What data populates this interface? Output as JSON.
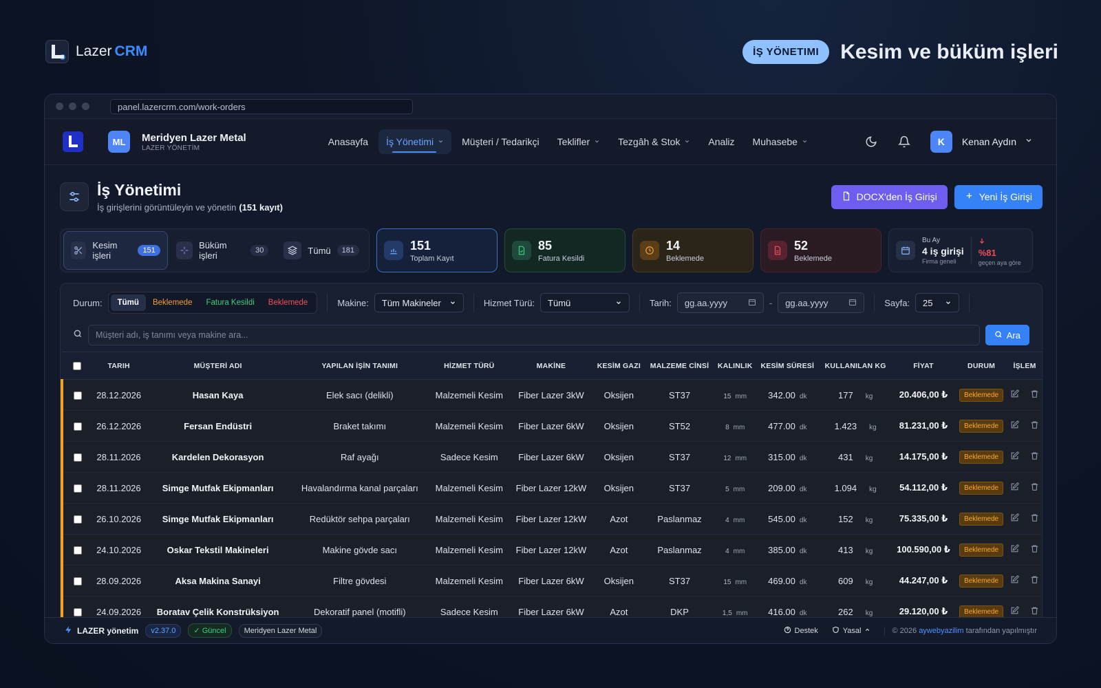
{
  "brand": {
    "name_light": "Lazer",
    "name_bold": "CRM"
  },
  "hero": {
    "badge": "İŞ YÖNETIMI",
    "title": "Kesim ve büküm işleri"
  },
  "browser": {
    "url": "panel.lazercrm.com/work-orders"
  },
  "org": {
    "initials": "ML",
    "name": "Meridyen Lazer Metal",
    "subtitle": "LAZER YÖNETİM"
  },
  "nav": {
    "items": [
      {
        "label": "Anasayfa",
        "dropdown": false,
        "active": false
      },
      {
        "label": "İş Yönetimi",
        "dropdown": true,
        "active": true
      },
      {
        "label": "Müşteri / Tedarikçi",
        "dropdown": false,
        "active": false
      },
      {
        "label": "Teklifler",
        "dropdown": true,
        "active": false
      },
      {
        "label": "Tezgâh & Stok",
        "dropdown": true,
        "active": false
      },
      {
        "label": "Analiz",
        "dropdown": false,
        "active": false
      },
      {
        "label": "Muhasebe",
        "dropdown": true,
        "active": false
      }
    ]
  },
  "user": {
    "initial": "K",
    "name": "Kenan Aydın"
  },
  "page": {
    "title": "İş Yönetimi",
    "subtitle": "İş girişlerini görüntüleyin ve yönetin",
    "count_text": "(151 kayıt)",
    "docx_button": "DOCX'den İş Girişi",
    "new_button": "Yeni İş Girişi"
  },
  "tabs": [
    {
      "label": "Kesim işleri",
      "count": "151",
      "icon": "scissors-icon"
    },
    {
      "label": "Büküm işleri",
      "count": "30",
      "icon": "sparkle-icon"
    },
    {
      "label": "Tümü",
      "count": "181",
      "icon": "layers-icon"
    }
  ],
  "stats": [
    {
      "value": "151",
      "label": "Toplam Kayıt",
      "icon": "bar-chart-icon",
      "accent": "#5b9bff"
    },
    {
      "value": "85",
      "label": "Fatura Kesildi",
      "icon": "invoice-icon",
      "accent": "#38d17d"
    },
    {
      "value": "14",
      "label": "Beklemede",
      "icon": "clock-icon",
      "accent": "#f59e34"
    },
    {
      "value": "52",
      "label": "Beklemede",
      "icon": "document-icon",
      "accent": "#f0505c"
    }
  ],
  "monthly": {
    "kicker": "Bu Ay",
    "value": "4 iş girişi",
    "scope": "Firma geneli",
    "delta": "%81",
    "delta_note": "geçen aya göre"
  },
  "filters": {
    "status_label": "Durum:",
    "status_options": [
      "Tümü",
      "Beklemede",
      "Fatura Kesildi",
      "Beklemede"
    ],
    "machine_label": "Makine:",
    "machine_value": "Tüm Makineler",
    "service_label": "Hizmet Türü:",
    "service_value": "Tümü",
    "date_label": "Tarih:",
    "date_placeholder_from": "gg.aa.yyyy",
    "date_sep": "-",
    "date_placeholder_to": "gg.aa.yyyy",
    "page_label": "Sayfa:",
    "page_value": "25"
  },
  "search": {
    "placeholder": "Müşteri adı, iş tanımı veya makine ara...",
    "button": "Ara"
  },
  "table": {
    "columns": [
      "TARIH",
      "MÜŞTERİ ADI",
      "YAPILAN İŞİN TANIMI",
      "HİZMET TÜRÜ",
      "MAKİNE",
      "KESİM GAZI",
      "MALZEME CİNSİ",
      "KALINLIK",
      "KESİM SÜRESİ",
      "KULLANILAN KG",
      "FİYAT",
      "DURUM",
      "İŞLEM"
    ],
    "rows": [
      {
        "date": "28.12.2026",
        "customer": "Hasan Kaya",
        "desc": "Elek sacı (delikli)",
        "service": "Malzemeli Kesim",
        "machine": "Fiber Lazer 3kW",
        "gas": "Oksijen",
        "material": "ST37",
        "thickness": "15",
        "thickness_unit": "mm",
        "duration": "342.00",
        "duration_unit": "dk",
        "kg": "177",
        "kg_unit": "kg",
        "price": "20.406,00 ₺",
        "status": "Beklemede"
      },
      {
        "date": "26.12.2026",
        "customer": "Fersan Endüstri",
        "desc": "Braket takımı",
        "service": "Malzemeli Kesim",
        "machine": "Fiber Lazer 6kW",
        "gas": "Oksijen",
        "material": "ST52",
        "thickness": "8",
        "thickness_unit": "mm",
        "duration": "477.00",
        "duration_unit": "dk",
        "kg": "1.423",
        "kg_unit": "kg",
        "price": "81.231,00 ₺",
        "status": "Beklemede"
      },
      {
        "date": "28.11.2026",
        "customer": "Kardelen Dekorasyon",
        "desc": "Raf ayağı",
        "service": "Sadece Kesim",
        "machine": "Fiber Lazer 6kW",
        "gas": "Oksijen",
        "material": "ST37",
        "thickness": "12",
        "thickness_unit": "mm",
        "duration": "315.00",
        "duration_unit": "dk",
        "kg": "431",
        "kg_unit": "kg",
        "price": "14.175,00 ₺",
        "status": "Beklemede"
      },
      {
        "date": "28.11.2026",
        "customer": "Simge Mutfak Ekipmanları",
        "desc": "Havalandırma kanal parçaları",
        "service": "Malzemeli Kesim",
        "machine": "Fiber Lazer 12kW",
        "gas": "Oksijen",
        "material": "ST37",
        "thickness": "5",
        "thickness_unit": "mm",
        "duration": "209.00",
        "duration_unit": "dk",
        "kg": "1.094",
        "kg_unit": "kg",
        "price": "54.112,00 ₺",
        "status": "Beklemede"
      },
      {
        "date": "26.10.2026",
        "customer": "Simge Mutfak Ekipmanları",
        "desc": "Redüktör sehpa parçaları",
        "service": "Malzemeli Kesim",
        "machine": "Fiber Lazer 12kW",
        "gas": "Azot",
        "material": "Paslanmaz",
        "thickness": "4",
        "thickness_unit": "mm",
        "duration": "545.00",
        "duration_unit": "dk",
        "kg": "152",
        "kg_unit": "kg",
        "price": "75.335,00 ₺",
        "status": "Beklemede"
      },
      {
        "date": "24.10.2026",
        "customer": "Oskar Tekstil Makineleri",
        "desc": "Makine gövde sacı",
        "service": "Malzemeli Kesim",
        "machine": "Fiber Lazer 12kW",
        "gas": "Azot",
        "material": "Paslanmaz",
        "thickness": "4",
        "thickness_unit": "mm",
        "duration": "385.00",
        "duration_unit": "dk",
        "kg": "413",
        "kg_unit": "kg",
        "price": "100.590,00 ₺",
        "status": "Beklemede"
      },
      {
        "date": "28.09.2026",
        "customer": "Aksa Makina Sanayi",
        "desc": "Filtre gövdesi",
        "service": "Malzemeli Kesim",
        "machine": "Fiber Lazer 6kW",
        "gas": "Oksijen",
        "material": "ST37",
        "thickness": "15",
        "thickness_unit": "mm",
        "duration": "469.00",
        "duration_unit": "dk",
        "kg": "609",
        "kg_unit": "kg",
        "price": "44.247,00 ₺",
        "status": "Beklemede"
      },
      {
        "date": "24.09.2026",
        "customer": "Boratav Çelik Konstrüksiyon",
        "desc": "Dekoratif panel (motifli)",
        "service": "Sadece Kesim",
        "machine": "Fiber Lazer 6kW",
        "gas": "Azot",
        "material": "DKP",
        "thickness": "1,5",
        "thickness_unit": "mm",
        "duration": "416.00",
        "duration_unit": "dk",
        "kg": "262",
        "kg_unit": "kg",
        "price": "29.120,00 ₺",
        "status": "Beklemede"
      }
    ]
  },
  "footer": {
    "brand": "LAZER yönetim",
    "version": "v2.37.0",
    "status": "Güncel",
    "company": "Meridyen Lazer Metal",
    "support": "Destek",
    "legal": "Yasal",
    "copy_prefix": "© 2026",
    "copy_link": "aywebyazilim",
    "copy_suffix": "tarafından yapılmıştır"
  },
  "colors": {
    "accent": "#3482f6",
    "purple": "#6d5ef0",
    "pending": "#f59e34",
    "row_accent": "#f2a31b"
  }
}
